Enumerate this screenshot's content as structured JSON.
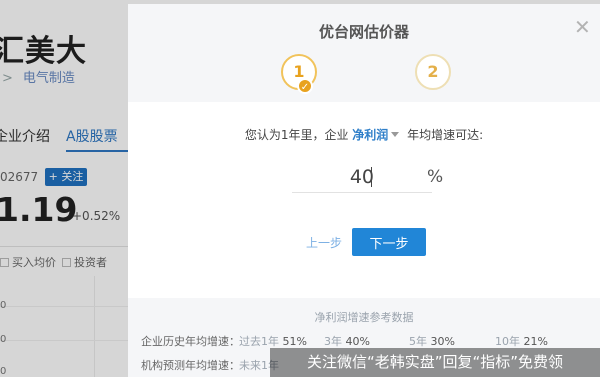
{
  "background": {
    "title": "汇美大",
    "breadcrumb_sep": ">",
    "breadcrumb": "电气制造",
    "tabs": [
      "企业介绍",
      "A股股票"
    ],
    "stock_code": "02677",
    "follow_label": "+ 关注",
    "price": "1.19",
    "change": "+0.52%",
    "filters": [
      "买入均价",
      "投资者"
    ],
    "axis_ticks": [
      "0",
      "0",
      "0"
    ]
  },
  "modal": {
    "title": "优台网估价器",
    "close_icon": "close-icon",
    "steps": [
      "1",
      "2"
    ],
    "question": {
      "prefix": "您认为1年里，企业",
      "metric": "净利润",
      "suffix": "年均增速可达:"
    },
    "input_value": "40",
    "unit": "%",
    "prev_label": "上一步",
    "next_label": "下一步",
    "reference": {
      "title": "净利润增速参考数据",
      "history_label": "企业历史年均增速：",
      "history": [
        {
          "k": "过去1年",
          "v": "51%"
        },
        {
          "k": "3年",
          "v": "40%"
        },
        {
          "k": "5年",
          "v": "30%"
        },
        {
          "k": "10年",
          "v": "21%"
        }
      ],
      "forecast_label": "机构预测年均增速：",
      "forecast_text": "未来1年"
    }
  },
  "watermark": "关注微信“老韩实盘”回复“指标”免费领",
  "colors": {
    "accent_blue": "#2186d7",
    "step_gold": "#e8a21e",
    "header_bg": "#f5f6f8"
  }
}
